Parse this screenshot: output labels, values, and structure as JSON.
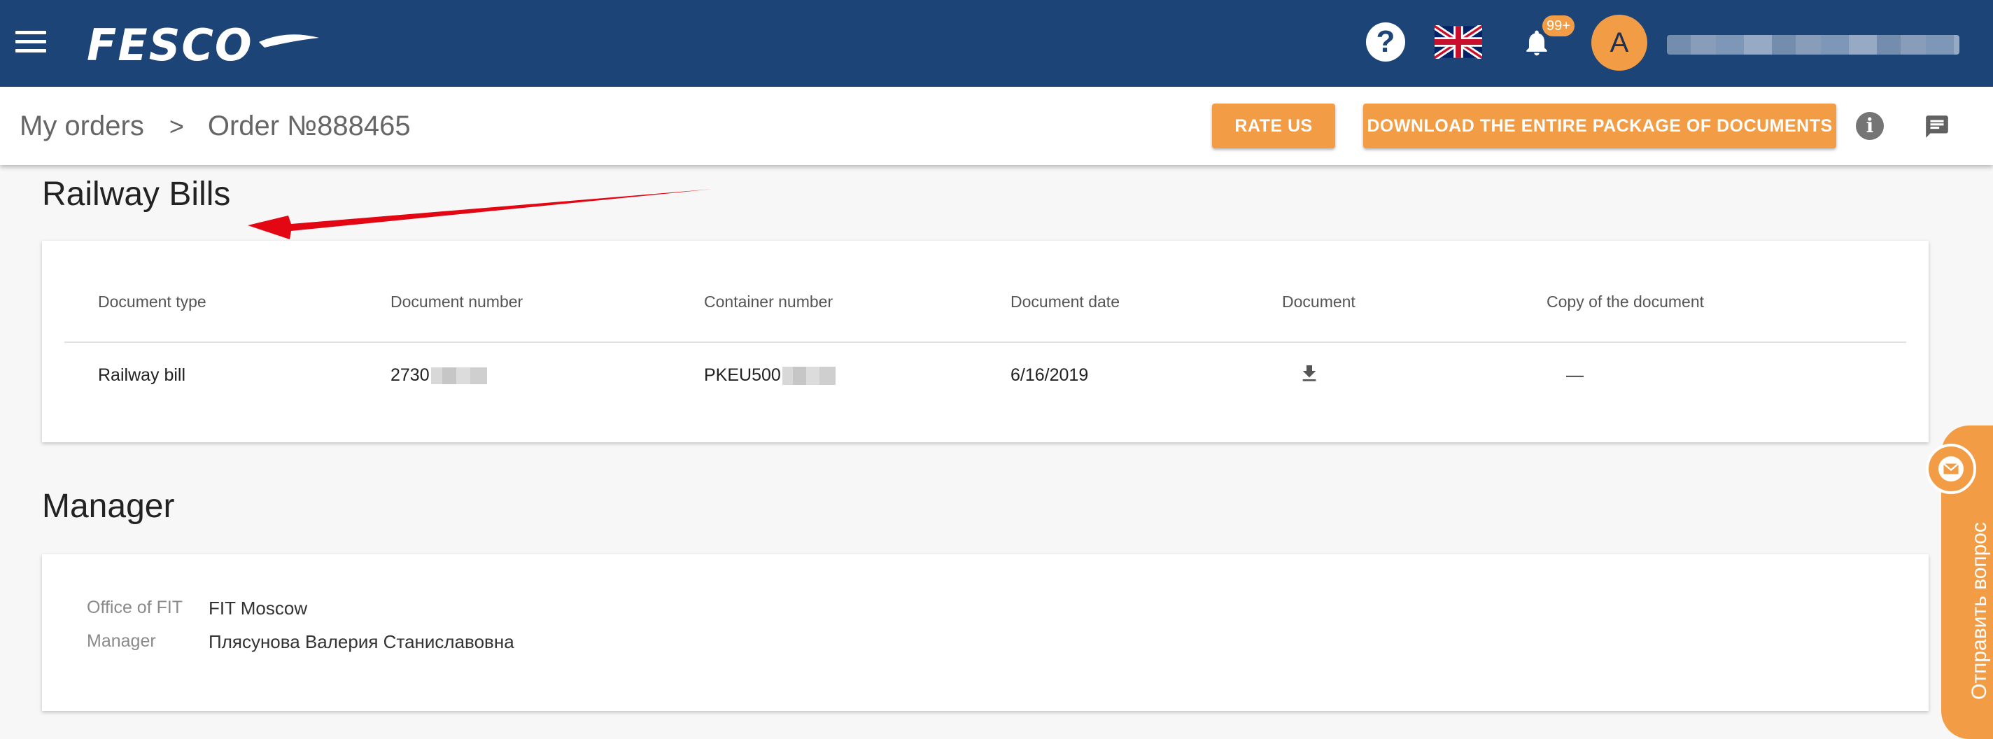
{
  "topbar": {
    "logo_text": "FESCO",
    "help_glyph": "?",
    "notifications_badge": "99+",
    "avatar_initial": "A"
  },
  "breadcrumb": {
    "my_orders": "My orders",
    "separator": ">",
    "order": "Order №888465"
  },
  "actions": {
    "rate_us": "RATE US",
    "download_all": "DOWNLOAD THE ENTIRE PACKAGE OF DOCUMENTS"
  },
  "railway": {
    "title": "Railway Bills",
    "columns": [
      "Document type",
      "Document number",
      "Container number",
      "Document date",
      "Document",
      "Copy of the document"
    ],
    "rows": [
      {
        "document_type": "Railway bill",
        "document_number": "2730",
        "container_number": "PKEU500",
        "document_date": "6/16/2019",
        "copy": "—"
      }
    ]
  },
  "manager": {
    "title": "Manager",
    "office_label": "Office of FIT",
    "office_value": "FIT Moscow",
    "manager_label": "Manager",
    "manager_value": "Плясунова Валерия Станиславовна"
  },
  "side_tab": {
    "label": "Отправить вопрос"
  },
  "colors": {
    "header_bg": "#1d4477",
    "accent": "#f29d45",
    "annotation_arrow": "#e30613"
  },
  "icons": [
    "menu-icon",
    "help-icon",
    "uk-flag-icon",
    "bell-icon",
    "info-icon",
    "chat-icon",
    "download-icon",
    "mail-icon"
  ]
}
